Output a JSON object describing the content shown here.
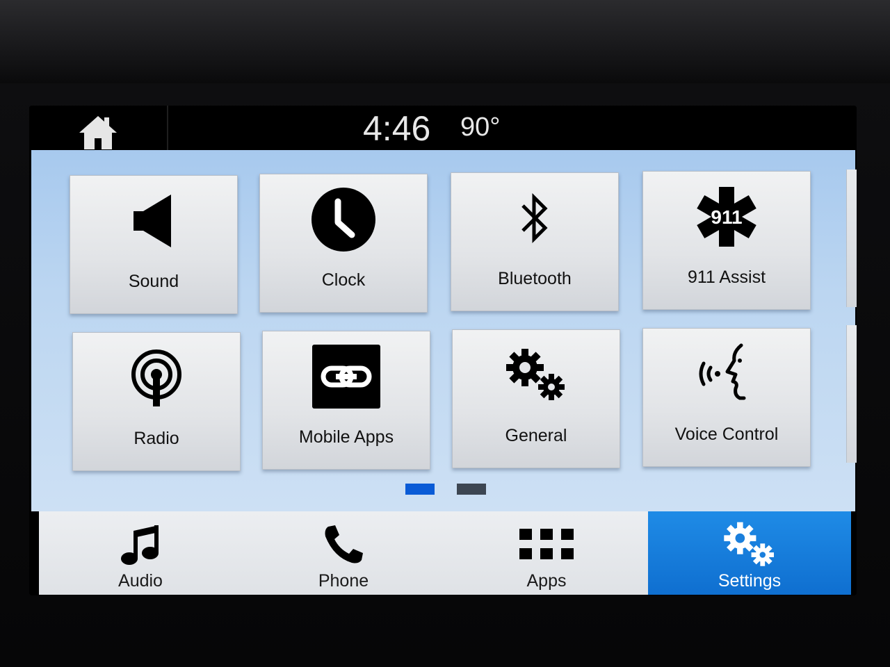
{
  "status": {
    "time": "4:46",
    "temperature": "90°"
  },
  "settings_tiles": [
    {
      "label": "Sound",
      "icon": "speaker-icon"
    },
    {
      "label": "Clock",
      "icon": "clock-icon"
    },
    {
      "label": "Bluetooth",
      "icon": "bluetooth-icon"
    },
    {
      "label": "911 Assist",
      "icon": "911-star-of-life-icon",
      "icon_text": "911"
    },
    {
      "label": "Radio",
      "icon": "radio-antenna-icon"
    },
    {
      "label": "Mobile Apps",
      "icon": "link-icon"
    },
    {
      "label": "General",
      "icon": "gears-icon"
    },
    {
      "label": "Voice Control",
      "icon": "voice-face-icon"
    }
  ],
  "pagination": {
    "page_count": 2,
    "current_page": 1,
    "active_color": "#0a5bd6",
    "inactive_color": "#3d4652"
  },
  "bottom_nav": [
    {
      "label": "Audio",
      "icon": "music-note-icon",
      "active": false
    },
    {
      "label": "Phone",
      "icon": "phone-handset-icon",
      "active": false
    },
    {
      "label": "Apps",
      "icon": "apps-grid-icon",
      "active": false
    },
    {
      "label": "Settings",
      "icon": "gears-icon",
      "active": true
    }
  ],
  "colors": {
    "accent": "#1a84e0",
    "background_top": "#a7c9ee",
    "tile": "#e6e8eb"
  }
}
